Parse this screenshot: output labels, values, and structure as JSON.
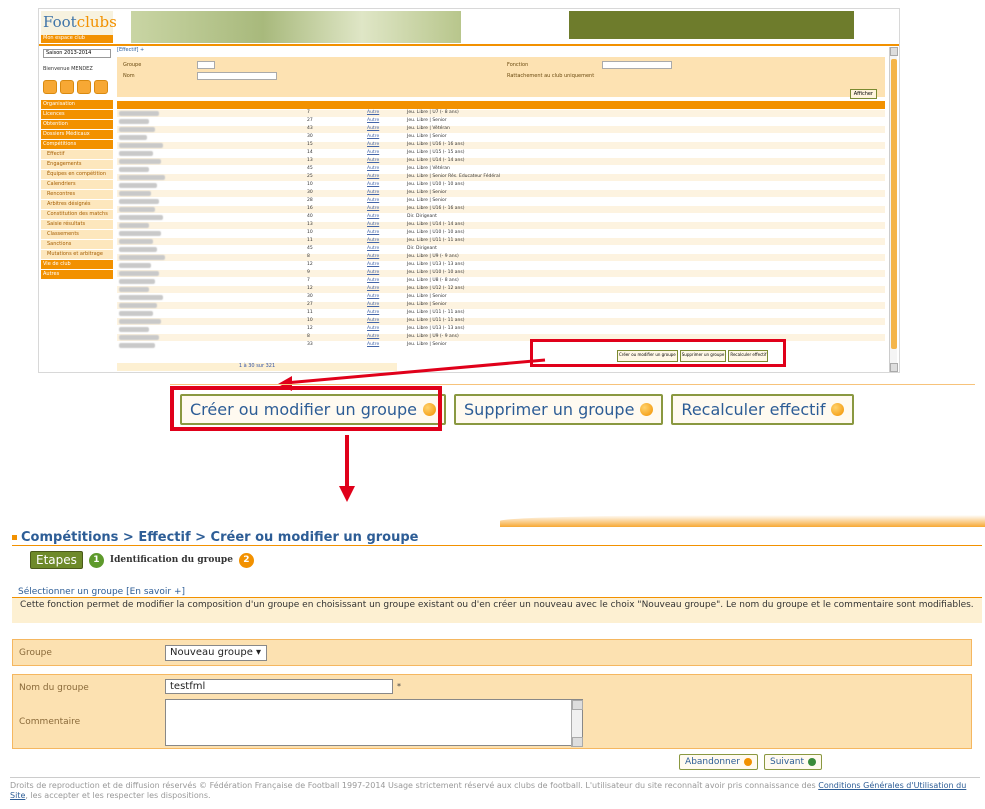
{
  "top_screen": {
    "logo_text_a": "Foot",
    "logo_text_b": "clubs",
    "logo_sub": "Mon espace club",
    "season": "Saison 2013-2014",
    "user_label": "Bienvenue MENDEZ",
    "breadcrumb": "[Effectif] +",
    "filter": {
      "groupe_label": "Groupe",
      "nom_label": "Nom",
      "fonction_label": "Fonction",
      "rattachement_label": "Rattachement au club uniquement",
      "afficher_label": "Afficher"
    },
    "nav_items": [
      "Organisation",
      "Licences",
      "Obtention",
      "Dossiers Médicaux",
      "Compétitions"
    ],
    "sub_items": [
      "Effectif",
      "Engagements",
      "Équipes en compétition",
      "Calendriers",
      "Rencontres",
      "Arbitres désignés",
      "Constitution des matchs",
      "Saisie résultats",
      "Classements",
      "Sanctions",
      "Mutations et arbitrage"
    ],
    "nav_bottom": [
      "Vie de club",
      "Autres"
    ],
    "rows": [
      {
        "age": "7",
        "cat": "Jeu. Libre | U7 (- 8 ans)"
      },
      {
        "age": "27",
        "cat": "Jeu. Libre | Senior"
      },
      {
        "age": "43",
        "cat": "Jeu. Libre | Vétéran"
      },
      {
        "age": "30",
        "cat": "Jeu. Libre | Senior"
      },
      {
        "age": "15",
        "cat": "Jeu. Libre | U16 (- 16 ans)"
      },
      {
        "age": "14",
        "cat": "Jeu. Libre | U15 (- 15 ans)"
      },
      {
        "age": "13",
        "cat": "Jeu. Libre | U14 (- 14 ans)"
      },
      {
        "age": "45",
        "cat": "Jeu. Libre | Vétéran"
      },
      {
        "age": "25",
        "cat": "Jeu. Libre | Senior Rés. Educateur Fédéral"
      },
      {
        "age": "10",
        "cat": "Jeu. Libre | U10 (- 10 ans)"
      },
      {
        "age": "30",
        "cat": "Jeu. Libre | Senior"
      },
      {
        "age": "28",
        "cat": "Jeu. Libre | Senior"
      },
      {
        "age": "16",
        "cat": "Jeu. Libre | U16 (- 16 ans)"
      },
      {
        "age": "40",
        "cat": "Dir. Dirigeant"
      },
      {
        "age": "13",
        "cat": "Jeu. Libre | U14 (- 14 ans)"
      },
      {
        "age": "10",
        "cat": "Jeu. Libre | U10 (- 10 ans)"
      },
      {
        "age": "11",
        "cat": "Jeu. Libre | U11 (- 11 ans)"
      },
      {
        "age": "45",
        "cat": "Dir. Dirigeant"
      },
      {
        "age": "8",
        "cat": "Jeu. Libre | U9 (- 9 ans)"
      },
      {
        "age": "12",
        "cat": "Jeu. Libre | U13 (- 13 ans)"
      },
      {
        "age": "9",
        "cat": "Jeu. Libre | U10 (- 10 ans)"
      },
      {
        "age": "7",
        "cat": "Jeu. Libre | U8 (- 8 ans)"
      },
      {
        "age": "12",
        "cat": "Jeu. Libre | U12 (- 12 ans)"
      },
      {
        "age": "30",
        "cat": "Jeu. Libre | Senior"
      },
      {
        "age": "27",
        "cat": "Jeu. Libre | Senior"
      },
      {
        "age": "11",
        "cat": "Jeu. Libre | U11 (- 11 ans)"
      },
      {
        "age": "10",
        "cat": "Jeu. Libre | U11 (- 11 ans)"
      },
      {
        "age": "12",
        "cat": "Jeu. Libre | U13 (- 13 ans)"
      },
      {
        "age": "8",
        "cat": "Jeu. Libre | U9 (- 9 ans)"
      },
      {
        "age": "33",
        "cat": "Jeu. Libre | Senior"
      }
    ],
    "link_text": "Autre",
    "pager": "1 à 30 sur 321",
    "small_buttons": [
      "Créer ou modifier un groupe",
      "Supprimer un groupe",
      "Recalculer effectif"
    ]
  },
  "big_buttons": {
    "create": "Créer ou modifier un groupe",
    "delete": "Supprimer un groupe",
    "recalc": "Recalculer effectif"
  },
  "page": {
    "title": "Compétitions > Effectif > Créer ou modifier un groupe",
    "etapes_label": "Etapes",
    "step1_num": "1",
    "step1_label": "Identification du groupe",
    "step2_num": "2",
    "select_link": "Sélectionner un groupe [En savoir +]",
    "info": "Cette fonction permet de modifier la composition d'un groupe en choisissant un groupe existant ou d'en créer un nouveau avec le choix \"Nouveau groupe\". Le nom du groupe et le commentaire sont modifiables.",
    "groupe_label": "Groupe",
    "groupe_value": "Nouveau groupe",
    "nom_label": "Nom du groupe",
    "nom_value": "testfml",
    "required": "*",
    "commentaire_label": "Commentaire",
    "abandon_label": "Abandonner",
    "suivant_label": "Suivant"
  },
  "footer": {
    "text": "Droits de reproduction et de diffusion réservés © Fédération Française de Football 1997-2014 Usage strictement réservé aux clubs de football. L'utilisateur du site reconnaît avoir pris connaissance des",
    "link": "Conditions Générales d'Utilisation du Site",
    "text2": ", les accepter et les respecter les dispositions."
  },
  "colors": {
    "orange": "#f29100",
    "blue": "#2d5d96",
    "red": "#e0001a",
    "green": "#6e8a2a"
  }
}
